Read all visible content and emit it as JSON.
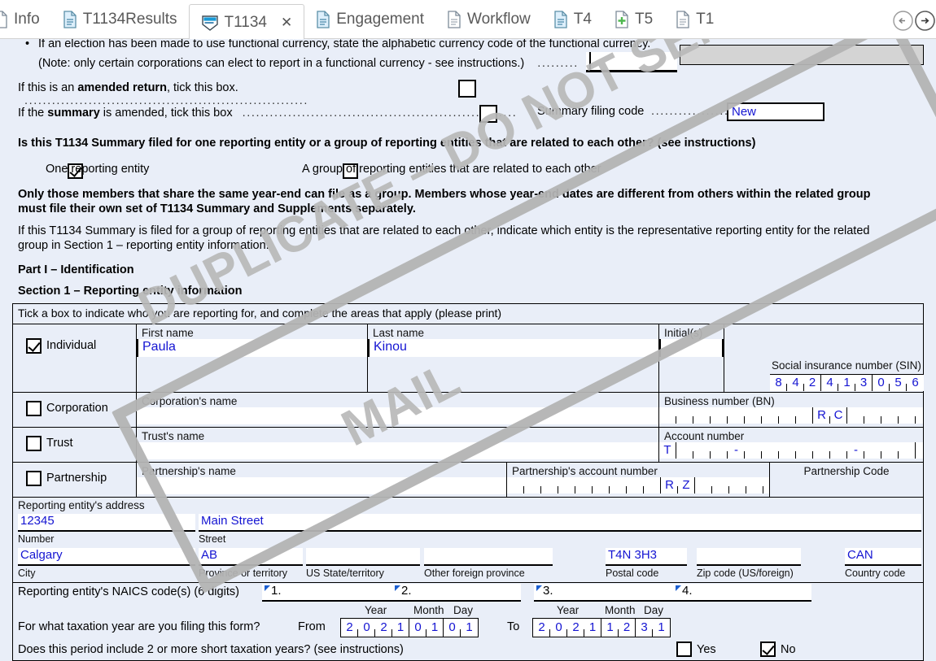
{
  "tabs": [
    {
      "label": "Info",
      "icon": "document-icon",
      "active": false,
      "clipped": true
    },
    {
      "label": "T1134Results",
      "icon": "document-icon",
      "active": false
    },
    {
      "label": "T1134",
      "icon": "form-shield-icon",
      "active": true,
      "close": "✕"
    },
    {
      "label": "Engagement",
      "icon": "document-icon",
      "active": false
    },
    {
      "label": "Workflow",
      "icon": "document-blank-icon",
      "active": false
    },
    {
      "label": "T4",
      "icon": "document-icon",
      "active": false
    },
    {
      "label": "T5",
      "icon": "document-add-icon",
      "active": false
    },
    {
      "label": "T1",
      "icon": "document-blank-icon",
      "active": false
    }
  ],
  "nav": {
    "back": "←",
    "forward": "→"
  },
  "watermark": {
    "line1": "DUPLICATE – DO NOT SEND BY",
    "line2": "MAIL"
  },
  "intro": {
    "bullet": "If an election has been made to use functional currency, state the alphabetic currency code of the functional currency.",
    "bullet_note": "(Note: only certain corporations can elect to report in a functional currency - see instructions.)",
    "bullet_dots": ".........",
    "currency_value": "",
    "amended_return_label_pre": "If this is an ",
    "amended_return_label_bold": "amended return",
    "amended_return_label_post": ", tick this box.",
    "amended_return_dots": "..............................................................",
    "amended_return_checked": false,
    "summary_amended_pre": "If the ",
    "summary_amended_bold": "summary",
    "summary_amended_post": " is amended, tick this box",
    "summary_amended_dots": "............................................................",
    "summary_amended_checked": false,
    "summary_filing_code_label": "Summary filing code",
    "summary_filing_code_dots": "..................",
    "summary_filing_code_value": "New"
  },
  "question": {
    "text": "Is this T1134 Summary filed for one reporting entity or a group of reporting entities that are related to each other? (see instructions)",
    "option_one_label": "One reporting entity",
    "option_one_checked": true,
    "option_group_label": "A group of reporting entities that are related to each other",
    "option_group_checked": false,
    "note_line1": "Only those members that share the same year-end can file as a group. Members whose year-end dates are different from others within the related group",
    "note_line2": "must file their own set of T1134 Summary and Supplements separately.",
    "para_line1": "If this T1134 Summary is filed for a group of reporting entities that are related to each other, indicate which entity is the representative reporting entity for the related",
    "para_line2": "group in Section 1 – reporting entity information."
  },
  "headings": {
    "part": "Part I – Identification",
    "section": "Section 1 – Reporting entity information"
  },
  "table": {
    "instruction": "Tick a box to indicate who you are reporting for, and complete the areas that apply (please print)",
    "individual": {
      "checkbox_label": "Individual",
      "checked": true,
      "first_name_label": "First name",
      "first_name_value": "Paula",
      "last_name_label": "Last name",
      "last_name_value": "Kinou",
      "initials_label": "Initial(s)",
      "initials_value": "",
      "sin_label": "Social insurance number (SIN)",
      "sin_digits": [
        "8",
        "4",
        "2",
        "4",
        "1",
        "3",
        "0",
        "5",
        "6"
      ]
    },
    "corporation": {
      "checkbox_label": "Corporation",
      "checked": false,
      "name_label": "Corporation's name",
      "name_value": "",
      "bn_label": "Business number (BN)",
      "bn_digits": [
        "",
        "",
        "",
        "",
        "",
        "",
        "",
        "",
        ""
      ],
      "bn_rc": [
        "R",
        "C"
      ],
      "bn_suffix": [
        "",
        "",
        "",
        ""
      ]
    },
    "trust": {
      "checkbox_label": "Trust",
      "checked": false,
      "name_label": "Trust's name",
      "name_value": "",
      "account_label": "Account number",
      "account_prefix": "T",
      "account_digits": [
        "",
        "",
        "",
        "-",
        "",
        "",
        "",
        "",
        "",
        "",
        "-",
        "",
        "",
        ""
      ]
    },
    "partnership": {
      "checkbox_label": "Partnership",
      "checked": false,
      "name_label": "Partnership's name",
      "name_value": "",
      "account_label": "Partnership's account number",
      "account_digits": [
        "",
        "",
        "",
        "",
        "",
        "",
        "",
        "",
        ""
      ],
      "account_rz": [
        "R",
        "Z"
      ],
      "account_suffix": [
        "",
        "",
        "",
        ""
      ],
      "code_label": "Partnership Code",
      "code_value": ""
    },
    "address": {
      "section_label": "Reporting entity's address",
      "number_value": "12345",
      "number_label": "Number",
      "street_value": "Main Street",
      "street_label": "Street",
      "city_value": "Calgary",
      "city_label": "City",
      "province_value": "AB",
      "province_label": "Province or territory",
      "us_state_value": "",
      "us_state_label": "US State/territory",
      "other_province_value": "",
      "other_province_label": "Other foreign province",
      "postal_value": "T4N 3H3",
      "postal_label": "Postal code",
      "zip_value": "",
      "zip_label": "Zip code (US/foreign)",
      "country_value": "CAN",
      "country_label": "Country code"
    },
    "naics": {
      "label": "Reporting entity's NAICS code(s) (6 digits)",
      "fields": [
        {
          "num": "1.",
          "value": ""
        },
        {
          "num": "2.",
          "value": ""
        },
        {
          "num": "3.",
          "value": ""
        },
        {
          "num": "4.",
          "value": ""
        }
      ]
    },
    "taxyear": {
      "question": "For what taxation year are you filing this form?",
      "from_label": "From",
      "to_label": "To",
      "year_header": "Year",
      "month_header": "Month",
      "day_header": "Day",
      "from_digits": [
        "2",
        "0",
        "2",
        "1",
        "0",
        "1",
        "0",
        "1"
      ],
      "to_digits": [
        "2",
        "0",
        "2",
        "1",
        "1",
        "2",
        "3",
        "1"
      ]
    },
    "short_years": {
      "question": "Does this period include 2 or more short taxation years? (see instructions)",
      "yes_label": "Yes",
      "yes_checked": false,
      "no_label": "No",
      "no_checked": true
    }
  },
  "colors": {
    "form_bg": "#e9eef8",
    "field_text": "#1414d2",
    "watermark": "#b3b3b3",
    "tab_text": "#595959"
  }
}
